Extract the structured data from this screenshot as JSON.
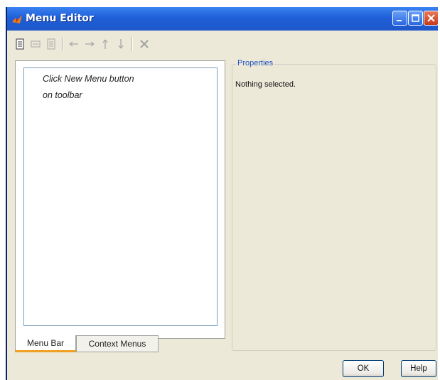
{
  "window": {
    "title": "Menu Editor",
    "controls": [
      "minimize",
      "maximize",
      "close"
    ]
  },
  "toolbar": {
    "items": [
      {
        "name": "new-menu-icon",
        "enabled": true
      },
      {
        "name": "new-menu-item-icon",
        "enabled": false
      },
      {
        "name": "new-context-menu-icon",
        "enabled": false
      },
      {
        "name": "move-left-icon",
        "enabled": false
      },
      {
        "name": "move-right-icon",
        "enabled": false
      },
      {
        "name": "move-up-icon",
        "enabled": false
      },
      {
        "name": "move-down-icon",
        "enabled": false
      },
      {
        "name": "delete-icon",
        "enabled": false
      }
    ]
  },
  "tree": {
    "hint_line1": "Click New Menu button",
    "hint_line2": "on toolbar"
  },
  "tabs": {
    "menu_bar": "Menu Bar",
    "context_menus": "Context Menus",
    "active": "Menu Bar"
  },
  "properties": {
    "legend": "Properties",
    "empty_text": "Nothing selected."
  },
  "buttons": {
    "ok": "OK",
    "help": "Help"
  },
  "colors": {
    "titlebar": "#1f5fd8",
    "dialog_bg": "#ece9d8",
    "active_tab_accent": "#f0a020"
  }
}
